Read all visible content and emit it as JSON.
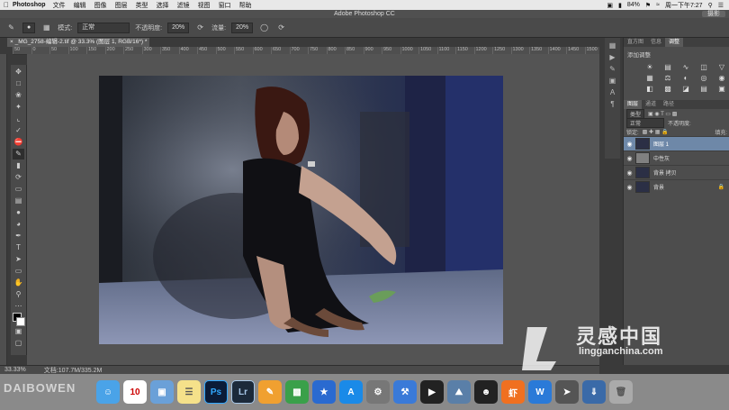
{
  "menubar": {
    "apple": "",
    "app": "Photoshop",
    "items": [
      "文件",
      "编辑",
      "图像",
      "图层",
      "类型",
      "选择",
      "滤镜",
      "视图",
      "窗口",
      "帮助"
    ],
    "battery": "84%",
    "clock": "周一下午7:27"
  },
  "window": {
    "title": "Adobe Photoshop CC",
    "workspace": "摄影"
  },
  "options": {
    "mode_label": "模式:",
    "mode_value": "正常",
    "opacity_label": "不透明度:",
    "opacity_value": "20%",
    "flow_label": "流量:",
    "flow_value": "20%"
  },
  "document": {
    "tab": "_MG_2758-编辑-2.tif @ 33.3% (图层 1, RGB/16*) *"
  },
  "ruler": [
    "50",
    "0",
    "50",
    "100",
    "150",
    "200",
    "250",
    "300",
    "350",
    "400",
    "450",
    "500",
    "550",
    "600",
    "650",
    "700",
    "750",
    "800",
    "850",
    "900",
    "950",
    "1000",
    "1050",
    "1100",
    "1150",
    "1200",
    "1250",
    "1300",
    "1350",
    "1400",
    "1450",
    "1500"
  ],
  "status": {
    "zoom": "33.33%",
    "doc": "文档:107.7M/335.2M"
  },
  "panels": {
    "tabs": [
      "直方图",
      "信息",
      "调整"
    ],
    "adjust_title": "添加调整",
    "layer_tabs": [
      "图层",
      "通道",
      "路径"
    ],
    "filter": "类型",
    "blend": "正常",
    "opacity_label": "不透明度:",
    "lock_label": "锁定:",
    "fill_label": "填充:",
    "layers": [
      {
        "name": "图层 1",
        "selected": true
      },
      {
        "name": "中性灰",
        "selected": false
      },
      {
        "name": "背景 拷贝",
        "selected": false
      },
      {
        "name": "背景",
        "selected": false,
        "locked": true
      }
    ]
  },
  "dock": {
    "calendar_day": "10",
    "ps": "Ps",
    "lr": "Lr",
    "qq_music": "虾",
    "word": "W"
  },
  "watermark": {
    "left": "DAIBOWEN",
    "brand": "灵感中国",
    "url": "lingganchina.com"
  },
  "colors": {
    "selected_layer": "#6e88a8",
    "dock_bg": "#8a8a8a"
  }
}
